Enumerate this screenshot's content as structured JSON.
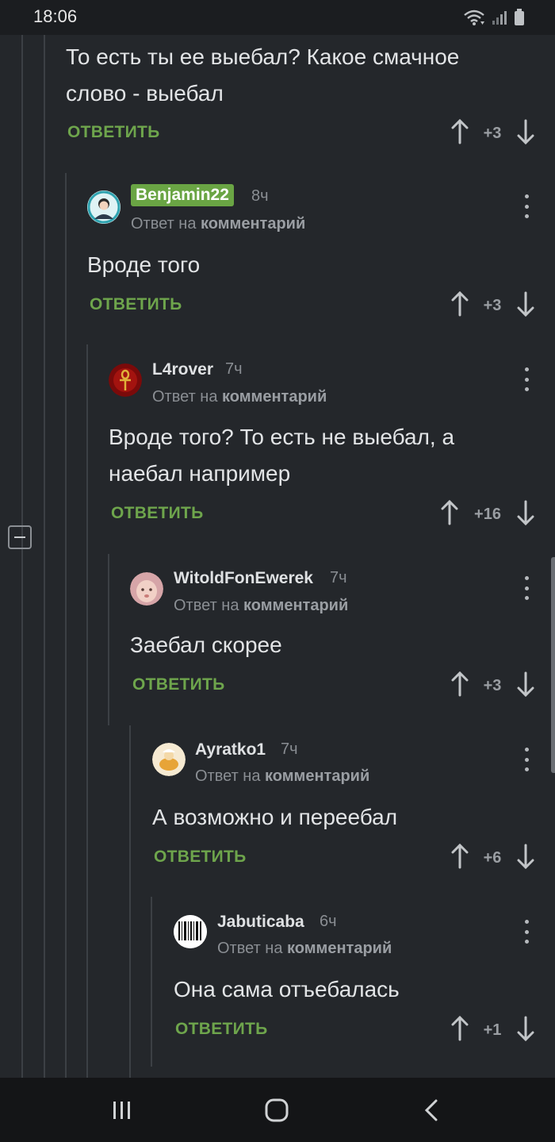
{
  "status_bar": {
    "time": "18:06"
  },
  "top_comment": {
    "text_lines": [
      "То есть ты ее выебал? Какое смачное",
      "слово - выебал"
    ],
    "reply_label": "ОТВЕТИТЬ",
    "rating": "+3"
  },
  "comments": [
    {
      "author": "Benjamin22",
      "time": "8ч",
      "reply_prefix": "Ответ на",
      "reply_target": "комментарий",
      "text_lines": [
        "Вроде того"
      ],
      "reply_label": "ОТВЕТИТЬ",
      "rating": "+3",
      "avatar": "user-avatar"
    },
    {
      "author": "L4rover",
      "time": "7ч",
      "reply_prefix": "Ответ на",
      "reply_target": "комментарий",
      "text_lines": [
        "Вроде того? То есть не выебал, а",
        "наебал например"
      ],
      "reply_label": "ОТВЕТИТЬ",
      "rating": "+16",
      "avatar": "ankh-avatar"
    },
    {
      "author": "WitoldFonEwerek",
      "time": "7ч",
      "reply_prefix": "Ответ на",
      "reply_target": "комментарий",
      "text_lines": [
        "Заебал скорее"
      ],
      "reply_label": "ОТВЕТИТЬ",
      "rating": "+3",
      "avatar": "baby-avatar"
    },
    {
      "author": "Ayratko1",
      "time": "7ч",
      "reply_prefix": "Ответ на",
      "reply_target": "комментарий",
      "text_lines": [
        "А возможно и переебал"
      ],
      "reply_label": "ОТВЕТИТЬ",
      "rating": "+6",
      "avatar": "cartoon-avatar"
    },
    {
      "author": "Jabuticaba",
      "time": "6ч",
      "reply_prefix": "Ответ на",
      "reply_target": "комментарий",
      "text_lines": [
        "Она сама отъебалась"
      ],
      "reply_label": "ОТВЕТИТЬ",
      "rating": "+1",
      "avatar": "barcode-avatar"
    }
  ],
  "icons": {
    "upvote": "arrow-up-icon",
    "downvote": "arrow-down-icon",
    "menu": "more-vertical-icon",
    "collapse": "minus-square-icon"
  },
  "colors": {
    "background": "#24272b",
    "accent_green": "#6ea54c",
    "highlight_badge": "#6aa544"
  }
}
